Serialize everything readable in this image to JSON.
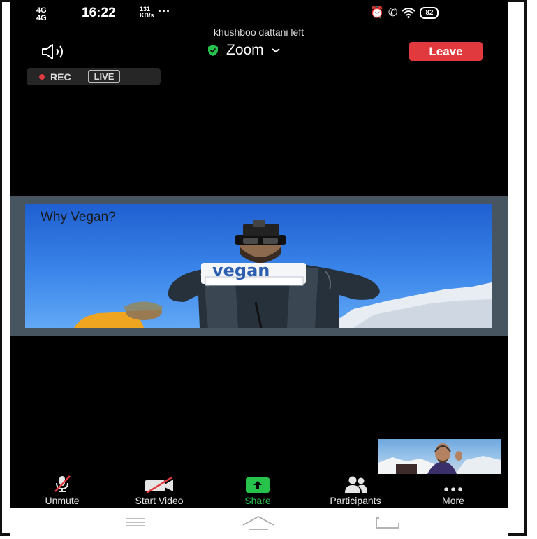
{
  "status_bar": {
    "network_1": "4G",
    "network_2": "4G",
    "time": "16:22",
    "speed_value": "131",
    "speed_unit": "KB/s",
    "more": "···",
    "battery": "82"
  },
  "notice": "khushboo dattani left",
  "header": {
    "title": "Zoom",
    "leave_label": "Leave"
  },
  "recording": {
    "rec_label": "REC",
    "live_label": "LIVE"
  },
  "shared_screen": {
    "slide_title": "Why Vegan?",
    "banner_text": "vegan"
  },
  "toolbar": {
    "unmute_label": "Unmute",
    "start_video_label": "Start Video",
    "share_label": "Share",
    "participants_label": "Participants",
    "more_label": "More"
  },
  "colors": {
    "leave": "#e03a3e",
    "share_green": "#27c24c",
    "shield_green": "#27c24c",
    "background": "#000000",
    "share_frame": "#475560"
  }
}
